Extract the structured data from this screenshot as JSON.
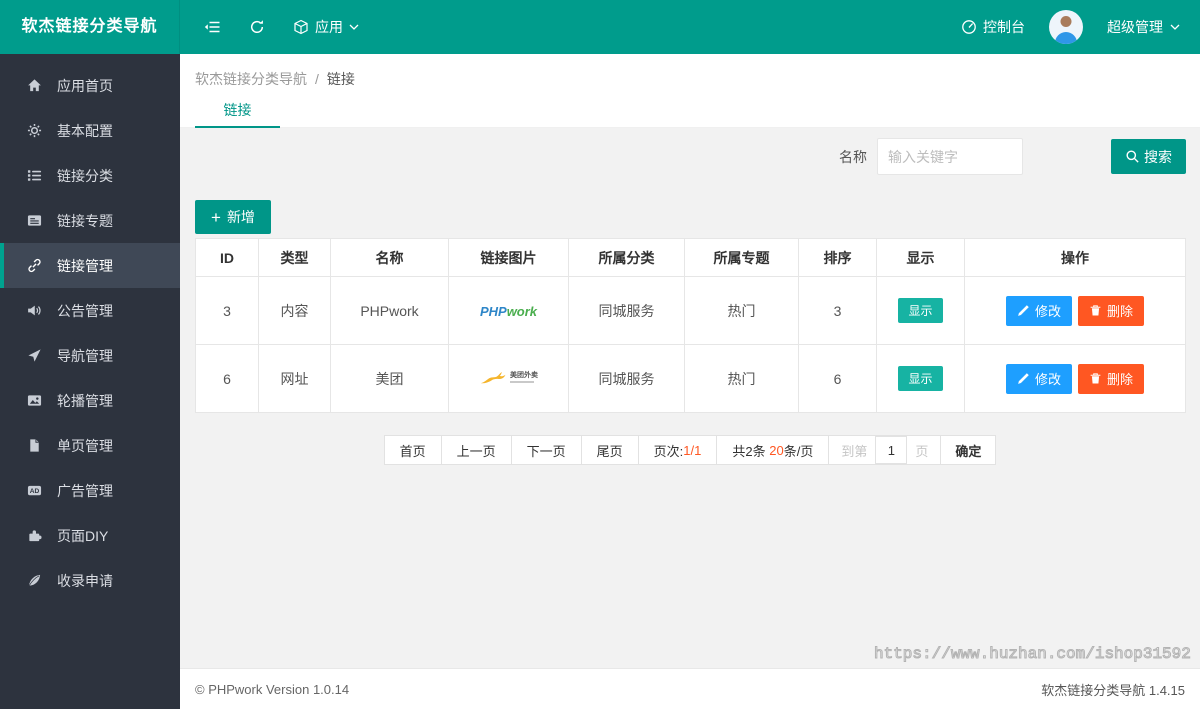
{
  "header": {
    "brand": "软杰链接分类导航",
    "app_label": "应用",
    "console_label": "控制台",
    "username": "超级管理"
  },
  "sidebar": {
    "items": [
      {
        "label": "应用首页",
        "icon": "home-icon",
        "active": false
      },
      {
        "label": "基本配置",
        "icon": "gear-icon",
        "active": false
      },
      {
        "label": "链接分类",
        "icon": "list-icon",
        "active": false
      },
      {
        "label": "链接专题",
        "icon": "card-icon",
        "active": false
      },
      {
        "label": "链接管理",
        "icon": "link-icon",
        "active": true
      },
      {
        "label": "公告管理",
        "icon": "speaker-icon",
        "active": false
      },
      {
        "label": "导航管理",
        "icon": "send-icon",
        "active": false
      },
      {
        "label": "轮播管理",
        "icon": "image-icon",
        "active": false
      },
      {
        "label": "单页管理",
        "icon": "file-icon",
        "active": false
      },
      {
        "label": "广告管理",
        "icon": "ad-icon",
        "active": false
      },
      {
        "label": "页面DIY",
        "icon": "puzzle-icon",
        "active": false
      },
      {
        "label": "收录申请",
        "icon": "feather-icon",
        "active": false
      }
    ]
  },
  "breadcrumb": {
    "parent": "软杰链接分类导航",
    "separator": "/",
    "current": "链接"
  },
  "tab": {
    "label": "链接"
  },
  "search": {
    "label": "名称",
    "placeholder": "输入关键字",
    "button": "搜索"
  },
  "toolbar": {
    "add": "新增"
  },
  "table": {
    "columns": [
      "ID",
      "类型",
      "名称",
      "链接图片",
      "所属分类",
      "所属专题",
      "排序",
      "显示",
      "操作"
    ],
    "action_edit": "修改",
    "action_delete": "删除",
    "rows": [
      {
        "id": "3",
        "type": "内容",
        "name": "PHPwork",
        "category": "同城服务",
        "topic": "热门",
        "sort": "3",
        "status": "显示",
        "logo": {
          "kind": "phpwork-logo",
          "part1": "PHP",
          "part2": "work"
        }
      },
      {
        "id": "6",
        "type": "网址",
        "name": "美团",
        "category": "同城服务",
        "topic": "热门",
        "sort": "6",
        "status": "显示",
        "logo": {
          "kind": "meituan-logo",
          "text": "美团外卖"
        }
      }
    ]
  },
  "pagination": {
    "first": "首页",
    "prev": "上一页",
    "next": "下一页",
    "last": "尾页",
    "page_label": "页次:",
    "page_value": "1/1",
    "total_label": "共2条",
    "limit_value": "20",
    "limit_suffix": "条/页",
    "skip_prefix": "到第",
    "skip_value": "1",
    "skip_suffix": "页",
    "confirm": "确定"
  },
  "footer": {
    "copyright": "© PHPwork Version 1.0.14",
    "version": "软杰链接分类导航 1.4.15"
  },
  "watermark": "https://www.huzhan.com/ishop31592",
  "icons": {
    "plus": "+"
  },
  "colors": {
    "header": "#009c8c",
    "sidebar": "#2d333e",
    "primary": "#009688",
    "edit_blue": "#1E9FFF",
    "delete_red": "#FF5722",
    "badge_teal": "#17b3a3",
    "red_text": "#FF5722"
  }
}
